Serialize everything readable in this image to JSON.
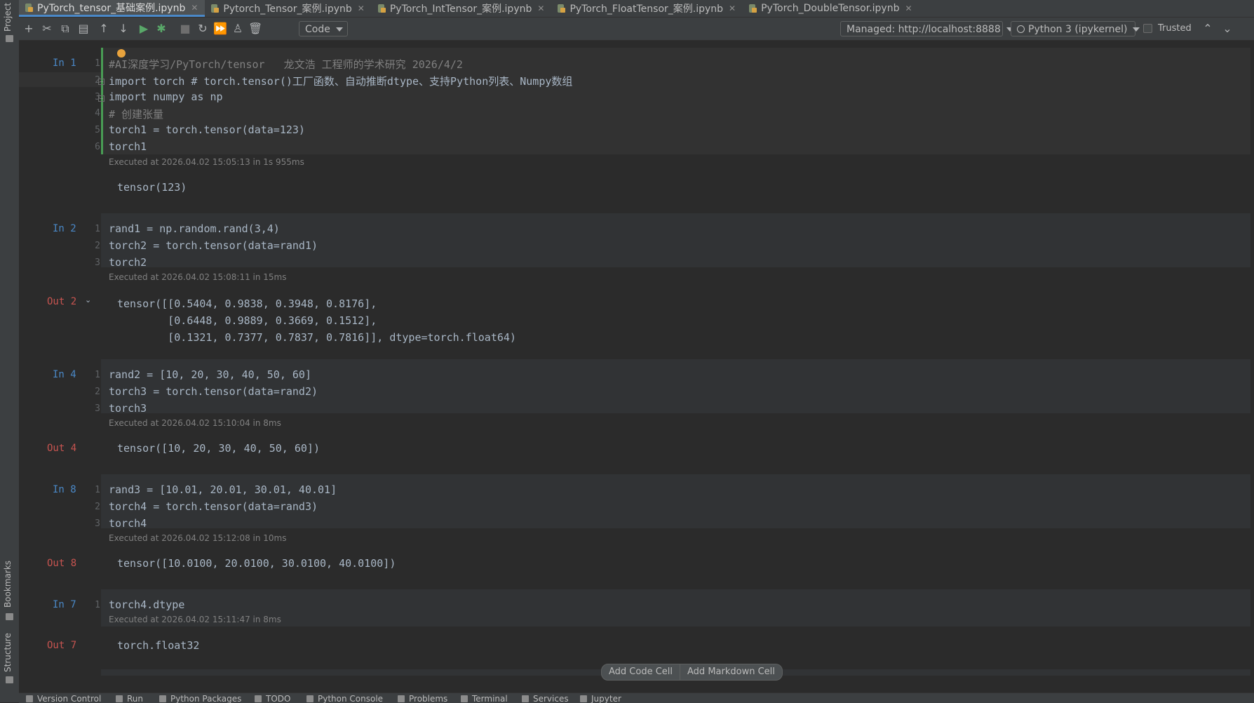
{
  "tabs": [
    {
      "label": "PyTorch_tensor_基础案例.ipynb",
      "active": true
    },
    {
      "label": "Pytorch_Tensor_案例.ipynb",
      "active": false
    },
    {
      "label": "PyTorch_IntTensor_案例.ipynb",
      "active": false
    },
    {
      "label": "PyTorch_FloatTensor_案例.ipynb",
      "active": false
    },
    {
      "label": "PyTorch_DoubleTensor.ipynb",
      "active": false
    }
  ],
  "toolbar": {
    "cell_type": "Code",
    "server": "Managed: http://localhost:8888",
    "kernel": "Python 3 (ipykernel)",
    "trusted_label": "Trusted"
  },
  "side": {
    "project": "Project",
    "bookmarks": "Bookmarks",
    "structure": "Structure"
  },
  "cells": [
    {
      "prompt": "In 1",
      "lines": [
        "#AI深度学习/PyTorch/tensor   龙文浩 工程师的学术研究 2026/4/2",
        "import torch # torch.tensor()工厂函数、自动推断dtype、支持Python列表、Numpy数组",
        "import numpy as np",
        "# 创建张量",
        "torch1 = torch.tensor(data=123)",
        "torch1"
      ],
      "executed": "Executed at 2026.04.02 15:05:13 in 1s 955ms",
      "out_prompt": "",
      "output": "tensor(123)"
    },
    {
      "prompt": "In 2",
      "lines": [
        "rand1 = np.random.rand(3,4)",
        "torch2 = torch.tensor(data=rand1)",
        "torch2"
      ],
      "executed": "Executed at 2026.04.02 15:08:11 in 15ms",
      "out_prompt": "Out 2",
      "output": "tensor([[0.5404, 0.9838, 0.3948, 0.8176],\n        [0.6448, 0.9889, 0.3669, 0.1512],\n        [0.1321, 0.7377, 0.7837, 0.7816]], dtype=torch.float64)"
    },
    {
      "prompt": "In 4",
      "lines": [
        "rand2 = [10, 20, 30, 40, 50, 60]",
        "torch3 = torch.tensor(data=rand2)",
        "torch3"
      ],
      "executed": "Executed at 2026.04.02 15:10:04 in 8ms",
      "out_prompt": "Out 4",
      "output": "tensor([10, 20, 30, 40, 50, 60])"
    },
    {
      "prompt": "In 8",
      "lines": [
        "rand3 = [10.01, 20.01, 30.01, 40.01]",
        "torch4 = torch.tensor(data=rand3)",
        "torch4"
      ],
      "executed": "Executed at 2026.04.02 15:12:08 in 10ms",
      "out_prompt": "Out 8",
      "output": "tensor([10.0100, 20.0100, 30.0100, 40.0100])"
    },
    {
      "prompt": "In 7",
      "lines": [
        "torch4.dtype"
      ],
      "executed": "Executed at 2026.04.02 15:11:47 in 8ms",
      "out_prompt": "Out 7",
      "output": "torch.float32"
    }
  ],
  "add_buttons": {
    "code": "Add Code Cell",
    "markdown": "Add Markdown Cell"
  },
  "statusbar": [
    "Version Control",
    "Run",
    "Python Packages",
    "TODO",
    "Python Console",
    "Problems",
    "Terminal",
    "Services",
    "Jupyter"
  ]
}
